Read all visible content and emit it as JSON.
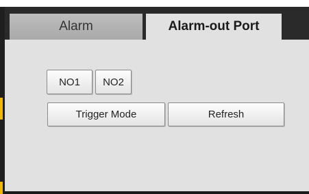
{
  "tabs": [
    {
      "label": "Alarm",
      "active": false
    },
    {
      "label": "Alarm-out Port",
      "active": true
    }
  ],
  "ports": [
    "NO1",
    "NO2"
  ],
  "actions": {
    "trigger_mode_label": "Trigger Mode",
    "refresh_label": "Refresh"
  },
  "colors": {
    "panel_bg": "#e1e1e1",
    "inactive_tab_bg": "#b3b3b3",
    "frame_dark": "#202020",
    "accent": "#f5b800"
  }
}
